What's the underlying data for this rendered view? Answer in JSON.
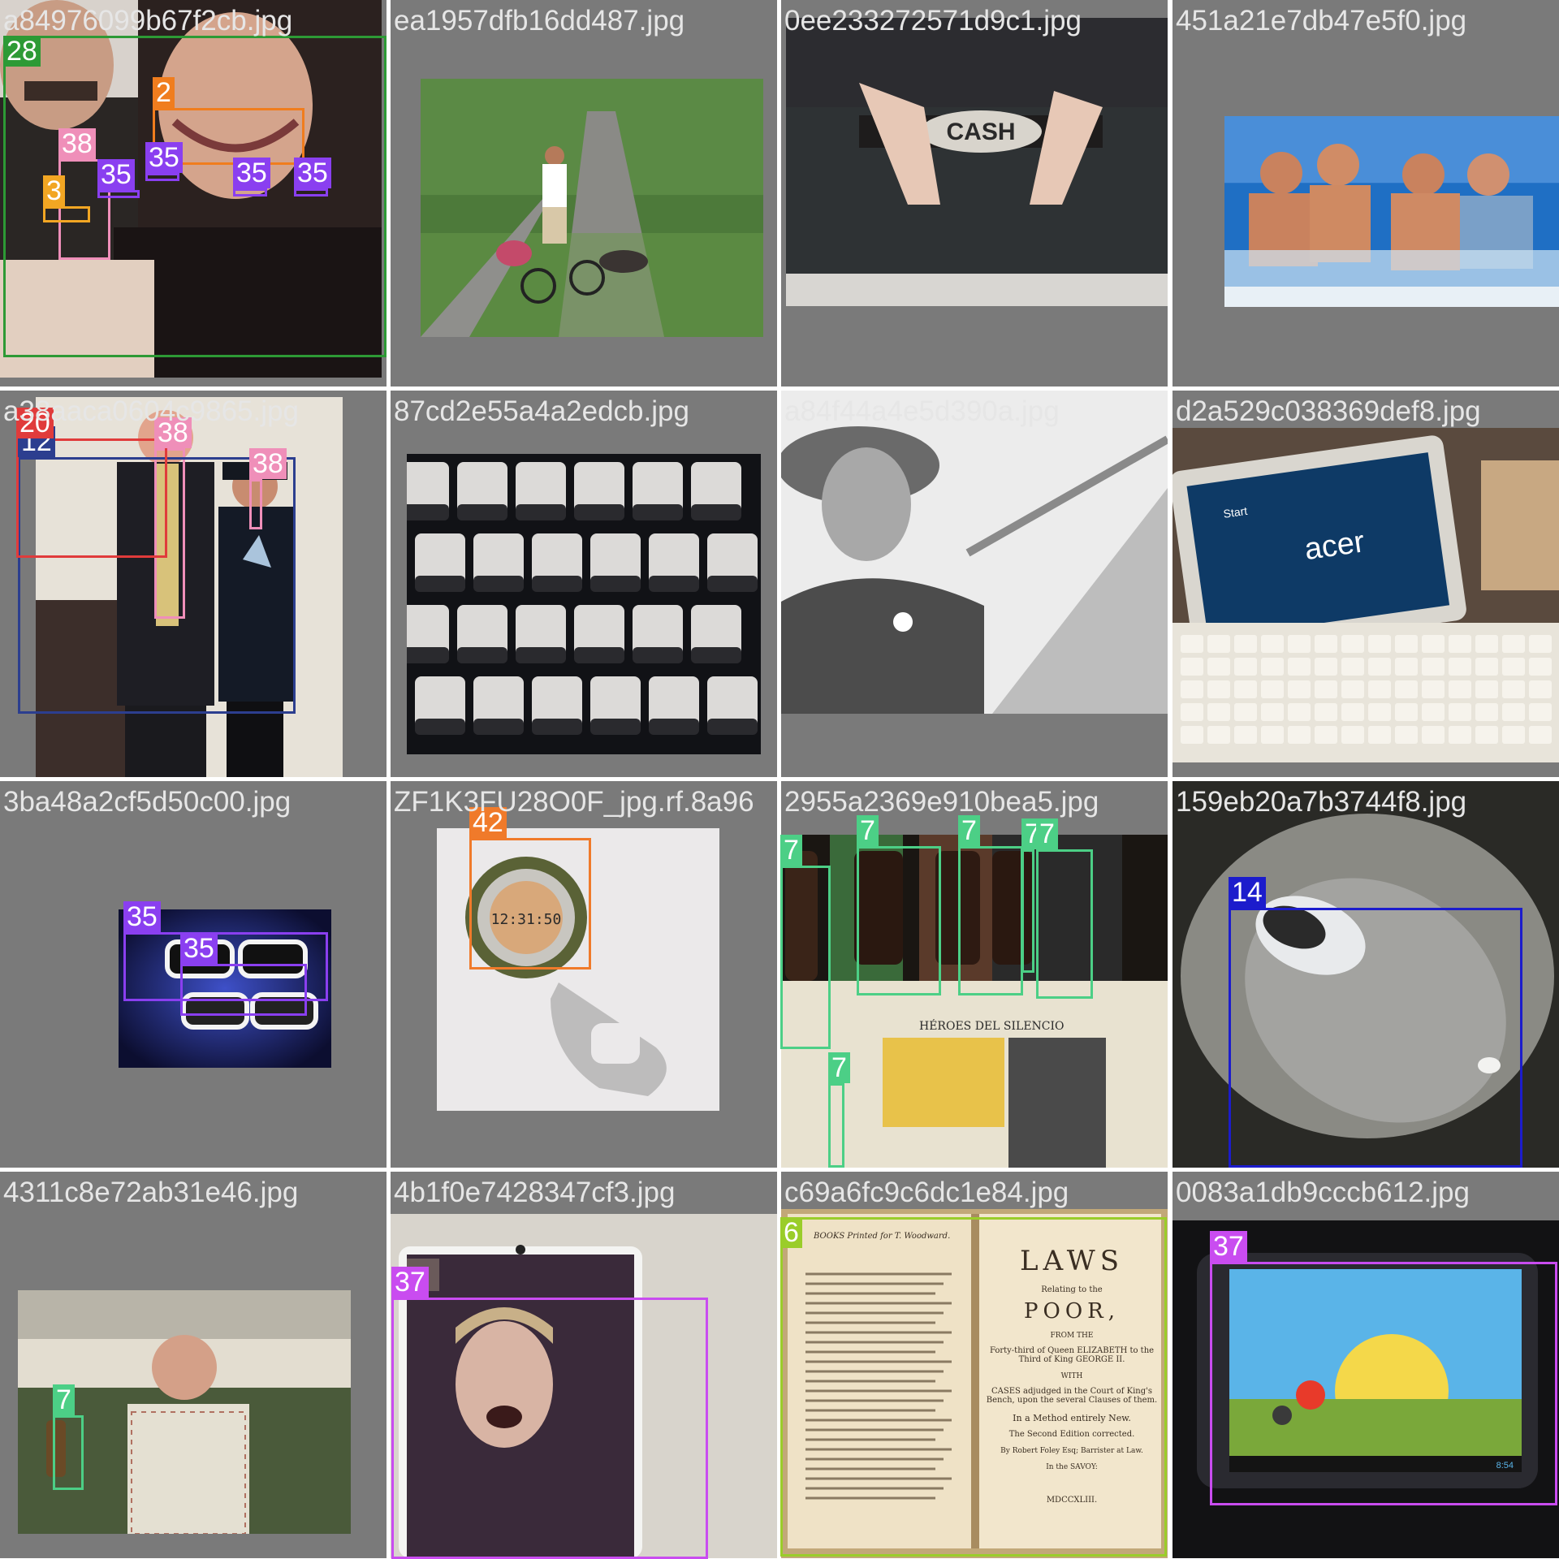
{
  "palette": {
    "38": "#ef8fb9",
    "3": "#f2a623",
    "2": "#f07d1e",
    "35": "#8a3ff0",
    "12": "#2c3e8f",
    "20": "#e03b3b",
    "28": "#2d9a35",
    "42": "#f07a2a",
    "7": "#4ccf86",
    "14": "#1c1ccc",
    "37": "#c94cf0",
    "6": "#9acd2a"
  },
  "tiles": [
    {
      "filename": "a84976099b67f2cb.jpg",
      "scene": "selfie-couple",
      "detections": [
        {
          "label": "38",
          "cls": "38"
        }
      ]
    },
    {
      "filename": "ea1957dfb16dd487.jpg",
      "scene": "cyclist-trail",
      "detections": [
        {
          "label": "3",
          "cls": "3"
        }
      ]
    },
    {
      "filename": "0ee233272571d9c1.jpg",
      "scene": "cash-belt-buckle",
      "detections": [
        {
          "label": "2",
          "cls": "2"
        }
      ]
    },
    {
      "filename": "451a21e7db47e5f0.jpg",
      "scene": "men-on-boat",
      "detections": [
        {
          "label": "35",
          "cls": "35"
        },
        {
          "label": "35",
          "cls": "35"
        },
        {
          "label": "35",
          "cls": "35"
        },
        {
          "label": "35",
          "cls": "35"
        }
      ]
    },
    {
      "filename": "a38aaca0604c9865.jpg",
      "scene": "officer-award",
      "detections": [
        {
          "label": "38",
          "cls": "38"
        },
        {
          "label": "38",
          "cls": "38"
        }
      ]
    },
    {
      "filename": "87cd2e55a4a2edcb.jpg",
      "scene": "keyboard-closeup",
      "detections": [
        {
          "label": "12",
          "cls": "12"
        }
      ]
    },
    {
      "filename": "a84f44a4e5d390a.jpg",
      "scene": "woman-cowboy-hat",
      "detections": [
        {
          "label": "20",
          "cls": "20"
        }
      ]
    },
    {
      "filename": "d2a529c038369def8.jpg",
      "scene": "acer-tablet-keyboard",
      "detections": [
        {
          "label": "28",
          "cls": "28"
        }
      ]
    },
    {
      "filename": "3ba48a2cf5d50c00.jpg",
      "scene": "white-sunglasses",
      "detections": [
        {
          "label": "35",
          "cls": "35"
        },
        {
          "label": "35",
          "cls": "35"
        }
      ]
    },
    {
      "filename": "ZF1K3FU28O0F_jpg.rf.8a96",
      "scene": "clip-watch",
      "detections": [
        {
          "label": "42",
          "cls": "42"
        }
      ]
    },
    {
      "filename": "2955a2369e910bea5.jpg",
      "scene": "beer-bottles",
      "detections": [
        {
          "label": "7",
          "cls": "7"
        },
        {
          "label": "7",
          "cls": "7"
        },
        {
          "label": "7",
          "cls": "7"
        },
        {
          "label": "7",
          "cls": "7"
        },
        {
          "label": "7",
          "cls": "7"
        },
        {
          "label": "7",
          "cls": "7"
        }
      ]
    },
    {
      "filename": "159eb20a7b3744f8.jpg",
      "scene": "computer-mouse",
      "detections": [
        {
          "label": "14",
          "cls": "14"
        }
      ]
    },
    {
      "filename": "4311c8e72ab31e46.jpg",
      "scene": "man-with-bottle",
      "detections": [
        {
          "label": "7",
          "cls": "7"
        }
      ]
    },
    {
      "filename": "4b1f0e7428347cf3.jpg",
      "scene": "video-call-screen",
      "detections": [
        {
          "label": "37",
          "cls": "37"
        }
      ]
    },
    {
      "filename": "c69a6fc9c6dc1e84.jpg",
      "scene": "old-book",
      "detections": [
        {
          "label": "6",
          "cls": "6"
        }
      ]
    },
    {
      "filename": "0083a1db9cccb612.jpg",
      "scene": "tablet-game",
      "detections": [
        {
          "label": "37",
          "cls": "37"
        }
      ]
    }
  ],
  "book": {
    "left_heading": "BOOKS Printed for T. Woodward.",
    "title": "LAWS",
    "relating": "Relating to the",
    "title2": "POOR,",
    "from_the": "FROM THE",
    "reign": "Forty-third of Queen ELIZABETH to the Third of King GEORGE II.",
    "with": "WITH",
    "cases": "CASES adjudged in the Court of King's Bench, upon the several Clauses of them.",
    "method": "In a Method entirely New.",
    "edition": "The Second Edition corrected.",
    "author": "By Robert Foley Esq; Barrister at Law.",
    "place": "In the SAVOY:",
    "year": "MDCCXLIII."
  },
  "screens": {
    "acer_brand": "acer",
    "tablet_start": "Start",
    "watch_time": "12:31:50",
    "belt_text": "CASH",
    "beer_brand": "HÉROES DEL SILENCIO",
    "tablet_clock": "8:54"
  }
}
